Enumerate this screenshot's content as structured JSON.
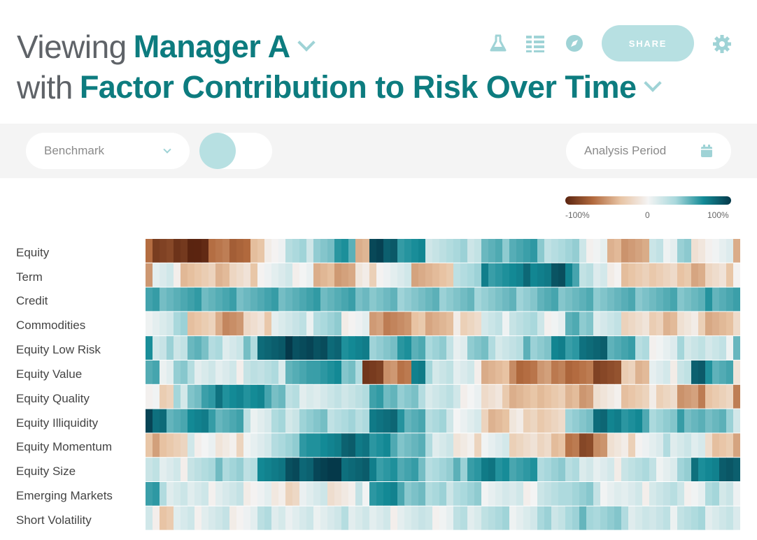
{
  "header": {
    "line1_prefix": "Viewing",
    "line1_value": "Manager A",
    "line2_prefix": "with",
    "line2_value": "Factor Contribution to Risk Over Time"
  },
  "toolbar": {
    "icons": [
      "flask-icon",
      "list-icon",
      "compass-icon",
      "gear-icon"
    ],
    "share_label": "SHARE"
  },
  "filters": {
    "benchmark_label": "Benchmark",
    "analysis_period_label": "Analysis Period"
  },
  "legend": {
    "min_label": "-100%",
    "mid_label": "0",
    "max_label": "100%"
  },
  "colors": {
    "accent": "#0d7c7f",
    "accent_light": "#b7e0e2",
    "negative": "#6b2a12",
    "positive": "#05394a"
  },
  "chart_data": {
    "type": "heatmap",
    "rows": [
      "Equity",
      "Term",
      "Credit",
      "Commodities",
      "Equity Low Risk",
      "Equity Value",
      "Equity Quality",
      "Equity Illiquidity",
      "Equity Momentum",
      "Equity Size",
      "Emerging Markets",
      "Short Volatility"
    ],
    "value_range": [
      -1,
      1
    ],
    "columns": 85,
    "segments": [
      [
        [
          0,
          -0.5
        ],
        [
          1,
          -0.8
        ],
        [
          4,
          -0.95
        ],
        [
          9,
          -0.6
        ],
        [
          15,
          -0.3
        ],
        [
          17,
          0.05
        ],
        [
          20,
          0.2
        ],
        [
          24,
          0.35
        ],
        [
          27,
          0.5
        ],
        [
          30,
          -0.3
        ],
        [
          32,
          0.9
        ],
        [
          36,
          0.55
        ],
        [
          40,
          0.2
        ],
        [
          48,
          0.4
        ],
        [
          52,
          0.5
        ],
        [
          56,
          0.25
        ],
        [
          62,
          0.05
        ],
        [
          66,
          -0.35
        ],
        [
          72,
          0.1
        ],
        [
          76,
          0.3
        ],
        [
          78,
          -0.15
        ],
        [
          80,
          0.05
        ],
        [
          84,
          -0.4
        ]
      ],
      [
        [
          0,
          -0.4
        ],
        [
          1,
          0.05
        ],
        [
          5,
          -0.25
        ],
        [
          12,
          -0.15
        ],
        [
          16,
          0.05
        ],
        [
          24,
          -0.35
        ],
        [
          30,
          -0.1
        ],
        [
          33,
          0.05
        ],
        [
          38,
          -0.3
        ],
        [
          44,
          0.25
        ],
        [
          48,
          0.6
        ],
        [
          54,
          0.7
        ],
        [
          58,
          0.85
        ],
        [
          60,
          0.55
        ],
        [
          62,
          0.2
        ],
        [
          64,
          0.05
        ],
        [
          68,
          -0.25
        ],
        [
          72,
          -0.15
        ],
        [
          76,
          -0.3
        ],
        [
          80,
          -0.15
        ],
        [
          84,
          0.05
        ]
      ],
      [
        [
          0,
          0.45
        ],
        [
          32,
          0.35
        ],
        [
          56,
          0.4
        ],
        [
          80,
          0.5
        ]
      ],
      [
        [
          0,
          0.1
        ],
        [
          4,
          0.2
        ],
        [
          6,
          -0.2
        ],
        [
          10,
          -0.4
        ],
        [
          14,
          -0.15
        ],
        [
          18,
          0.1
        ],
        [
          24,
          0.25
        ],
        [
          28,
          0.05
        ],
        [
          32,
          -0.45
        ],
        [
          38,
          -0.3
        ],
        [
          44,
          -0.1
        ],
        [
          48,
          0.1
        ],
        [
          52,
          0.2
        ],
        [
          56,
          0.05
        ],
        [
          60,
          0.4
        ],
        [
          64,
          0.1
        ],
        [
          68,
          -0.1
        ],
        [
          72,
          -0.25
        ],
        [
          76,
          -0.1
        ],
        [
          80,
          -0.3
        ],
        [
          84,
          -0.2
        ]
      ],
      [
        [
          0,
          0.6
        ],
        [
          1,
          0.1
        ],
        [
          3,
          0.2
        ],
        [
          6,
          0.4
        ],
        [
          8,
          0.3
        ],
        [
          11,
          0.1
        ],
        [
          14,
          0.3
        ],
        [
          16,
          0.8
        ],
        [
          20,
          0.95
        ],
        [
          24,
          0.85
        ],
        [
          28,
          0.6
        ],
        [
          32,
          0.35
        ],
        [
          36,
          0.5
        ],
        [
          40,
          0.25
        ],
        [
          44,
          0.1
        ],
        [
          46,
          0.3
        ],
        [
          50,
          0.15
        ],
        [
          54,
          0.35
        ],
        [
          58,
          0.6
        ],
        [
          62,
          0.75
        ],
        [
          66,
          0.5
        ],
        [
          70,
          0.15
        ],
        [
          72,
          0.05
        ],
        [
          76,
          0.2
        ],
        [
          80,
          0.1
        ],
        [
          84,
          0.45
        ]
      ],
      [
        [
          0,
          0.4
        ],
        [
          2,
          0.1
        ],
        [
          4,
          0.3
        ],
        [
          6,
          0.15
        ],
        [
          10,
          0.05
        ],
        [
          14,
          0.2
        ],
        [
          16,
          0.15
        ],
        [
          20,
          0.45
        ],
        [
          24,
          0.6
        ],
        [
          28,
          0.3
        ],
        [
          31,
          -0.85
        ],
        [
          34,
          -0.5
        ],
        [
          38,
          0.65
        ],
        [
          40,
          0.2
        ],
        [
          44,
          0.05
        ],
        [
          48,
          -0.3
        ],
        [
          52,
          -0.55
        ],
        [
          56,
          -0.45
        ],
        [
          60,
          -0.6
        ],
        [
          64,
          -0.75
        ],
        [
          68,
          -0.25
        ],
        [
          72,
          0.05
        ],
        [
          76,
          0.2
        ],
        [
          78,
          0.8
        ],
        [
          80,
          0.5
        ],
        [
          84,
          -0.1
        ]
      ],
      [
        [
          0,
          0.05
        ],
        [
          2,
          -0.2
        ],
        [
          4,
          0.2
        ],
        [
          6,
          0.4
        ],
        [
          8,
          0.5
        ],
        [
          10,
          0.65
        ],
        [
          14,
          0.55
        ],
        [
          18,
          0.4
        ],
        [
          20,
          0.15
        ],
        [
          24,
          0.1
        ],
        [
          28,
          0.2
        ],
        [
          32,
          0.45
        ],
        [
          36,
          0.3
        ],
        [
          40,
          0.15
        ],
        [
          44,
          0.05
        ],
        [
          48,
          -0.15
        ],
        [
          52,
          -0.3
        ],
        [
          56,
          -0.2
        ],
        [
          60,
          -0.35
        ],
        [
          64,
          -0.1
        ],
        [
          68,
          -0.2
        ],
        [
          72,
          -0.1
        ],
        [
          76,
          -0.45
        ],
        [
          80,
          -0.2
        ],
        [
          84,
          -0.6
        ]
      ],
      [
        [
          0,
          0.95
        ],
        [
          1,
          0.7
        ],
        [
          3,
          0.5
        ],
        [
          6,
          0.6
        ],
        [
          10,
          0.45
        ],
        [
          14,
          0.1
        ],
        [
          18,
          0.2
        ],
        [
          22,
          0.3
        ],
        [
          26,
          0.25
        ],
        [
          30,
          0.15
        ],
        [
          32,
          0.75
        ],
        [
          36,
          0.5
        ],
        [
          40,
          0.2
        ],
        [
          44,
          0.05
        ],
        [
          48,
          -0.25
        ],
        [
          52,
          -0.1
        ],
        [
          56,
          -0.2
        ],
        [
          60,
          0.35
        ],
        [
          64,
          0.7
        ],
        [
          68,
          0.55
        ],
        [
          72,
          0.3
        ],
        [
          76,
          0.45
        ],
        [
          80,
          0.35
        ],
        [
          84,
          0.15
        ]
      ],
      [
        [
          0,
          -0.3
        ],
        [
          2,
          -0.2
        ],
        [
          6,
          0.05
        ],
        [
          10,
          -0.1
        ],
        [
          14,
          0.05
        ],
        [
          18,
          0.3
        ],
        [
          22,
          0.5
        ],
        [
          24,
          0.65
        ],
        [
          28,
          0.75
        ],
        [
          32,
          0.55
        ],
        [
          36,
          0.4
        ],
        [
          40,
          0.15
        ],
        [
          44,
          -0.1
        ],
        [
          48,
          0.05
        ],
        [
          52,
          -0.1
        ],
        [
          56,
          -0.2
        ],
        [
          60,
          -0.55
        ],
        [
          62,
          -0.85
        ],
        [
          64,
          -0.4
        ],
        [
          66,
          -0.1
        ],
        [
          70,
          0.05
        ],
        [
          74,
          0.15
        ],
        [
          78,
          0.05
        ],
        [
          80,
          -0.2
        ],
        [
          84,
          -0.4
        ]
      ],
      [
        [
          0,
          0.2
        ],
        [
          2,
          0.05
        ],
        [
          6,
          0.2
        ],
        [
          10,
          0.3
        ],
        [
          14,
          0.15
        ],
        [
          16,
          0.7
        ],
        [
          20,
          0.85
        ],
        [
          24,
          0.95
        ],
        [
          28,
          0.8
        ],
        [
          32,
          0.6
        ],
        [
          36,
          0.45
        ],
        [
          40,
          0.25
        ],
        [
          44,
          0.35
        ],
        [
          46,
          0.55
        ],
        [
          48,
          0.65
        ],
        [
          52,
          0.5
        ],
        [
          56,
          0.3
        ],
        [
          60,
          0.15
        ],
        [
          64,
          0.05
        ],
        [
          68,
          0.2
        ],
        [
          72,
          0.1
        ],
        [
          76,
          0.25
        ],
        [
          78,
          0.65
        ],
        [
          82,
          0.8
        ],
        [
          84,
          0.9
        ]
      ],
      [
        [
          0,
          0.5
        ],
        [
          2,
          0.15
        ],
        [
          6,
          0.05
        ],
        [
          10,
          0.1
        ],
        [
          14,
          0.05
        ],
        [
          18,
          -0.1
        ],
        [
          22,
          0.05
        ],
        [
          26,
          -0.05
        ],
        [
          30,
          0.1
        ],
        [
          32,
          0.6
        ],
        [
          36,
          0.4
        ],
        [
          40,
          0.2
        ],
        [
          44,
          0.25
        ],
        [
          48,
          0.1
        ],
        [
          52,
          0.05
        ],
        [
          56,
          0.15
        ],
        [
          60,
          0.3
        ],
        [
          64,
          0.1
        ],
        [
          68,
          0.05
        ],
        [
          72,
          0.15
        ],
        [
          76,
          0.05
        ],
        [
          80,
          0.2
        ],
        [
          84,
          0.05
        ]
      ],
      [
        [
          0,
          0.05
        ],
        [
          2,
          -0.2
        ],
        [
          4,
          0.05
        ],
        [
          8,
          0.1
        ],
        [
          12,
          0.05
        ],
        [
          16,
          0.15
        ],
        [
          20,
          0.05
        ],
        [
          24,
          0.1
        ],
        [
          28,
          0.15
        ],
        [
          32,
          0.05
        ],
        [
          36,
          0.1
        ],
        [
          40,
          0.05
        ],
        [
          44,
          0.15
        ],
        [
          48,
          0.2
        ],
        [
          52,
          0.1
        ],
        [
          56,
          0.2
        ],
        [
          60,
          0.25
        ],
        [
          62,
          0.35
        ],
        [
          64,
          0.3
        ],
        [
          68,
          0.15
        ],
        [
          72,
          0.1
        ],
        [
          76,
          0.2
        ],
        [
          80,
          0.15
        ],
        [
          84,
          0.05
        ]
      ]
    ]
  }
}
